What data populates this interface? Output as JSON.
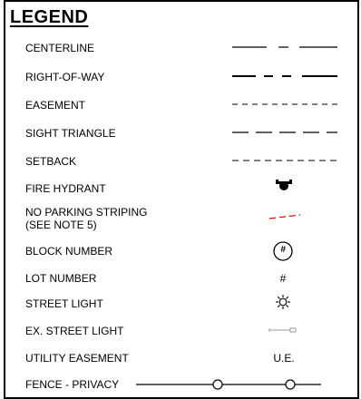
{
  "title": "LEGEND",
  "rows": [
    {
      "label": "CENTERLINE",
      "icon": "centerline-linetype"
    },
    {
      "label": "RIGHT-OF-WAY",
      "icon": "right-of-way-linetype"
    },
    {
      "label": "EASEMENT",
      "icon": "easement-linetype"
    },
    {
      "label": "SIGHT TRIANGLE",
      "icon": "sight-triangle-linetype"
    },
    {
      "label": "SETBACK",
      "icon": "setback-linetype"
    },
    {
      "label": "FIRE HYDRANT",
      "icon": "fire-hydrant-icon"
    },
    {
      "label_line1": "NO PARKING STRIPING",
      "label_line2": "(SEE NOTE 5)",
      "icon": "no-parking-striping-linetype",
      "color": "#e00000"
    },
    {
      "label": "BLOCK NUMBER",
      "symbol_text": "#",
      "icon": "circled-hash-icon"
    },
    {
      "label": "LOT NUMBER",
      "symbol_text": "#"
    },
    {
      "label": "STREET LIGHT",
      "icon": "street-light-icon"
    },
    {
      "label": "EX. STREET LIGHT",
      "icon": "existing-street-light-icon",
      "color": "#9a9a9a"
    },
    {
      "label": "UTILITY EASEMENT",
      "symbol_text": "U.E."
    },
    {
      "label": "FENCE - PRIVACY",
      "icon": "fence-privacy-linetype"
    }
  ]
}
